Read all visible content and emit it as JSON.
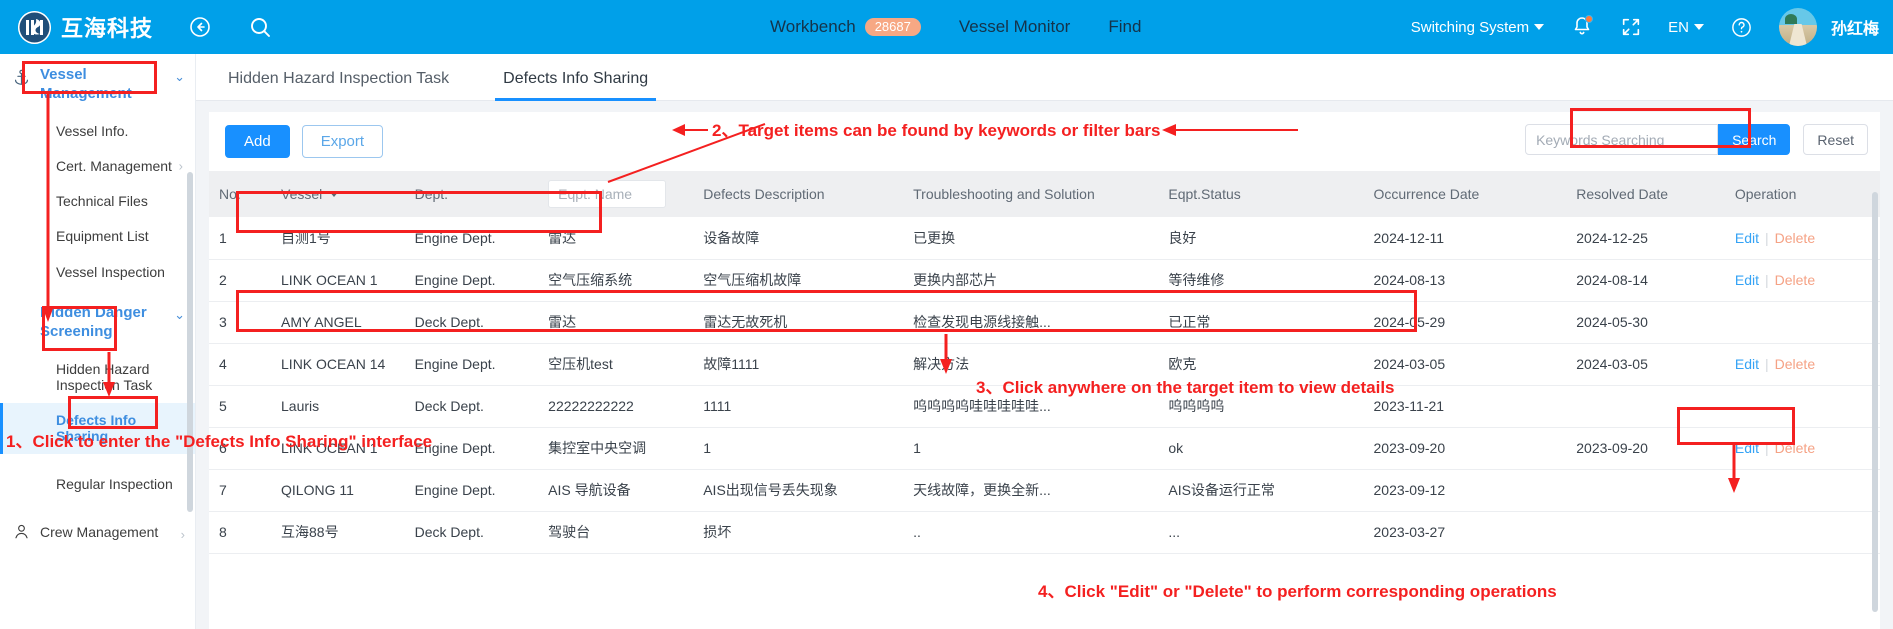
{
  "topbar": {
    "brand_name": "互海科技",
    "back_icon": "back-arrow-icon",
    "search_icon": "search-icon",
    "nav": [
      {
        "label": "Workbench",
        "badge": "28687"
      },
      {
        "label": "Vessel Monitor",
        "badge": ""
      },
      {
        "label": "Find",
        "badge": ""
      }
    ],
    "switching_system": "Switching System",
    "language": "EN",
    "user_name": "孙红梅"
  },
  "sidebar": {
    "groups": [
      {
        "label": "Vessel Management",
        "icon": "anchor-icon",
        "expanded": true,
        "items": [
          {
            "label": "Vessel Info.",
            "has_arrow": false
          },
          {
            "label": "Cert. Management",
            "has_arrow": true
          },
          {
            "label": "Technical Files",
            "has_arrow": false
          },
          {
            "label": "Equipment List",
            "has_arrow": false
          },
          {
            "label": "Vessel Inspection",
            "has_arrow": false
          }
        ]
      },
      {
        "label": "Hidden Danger Screening",
        "icon": "chevron-down-icon",
        "expanded": true,
        "items": [
          {
            "label": "Hidden Hazard Inspection Task",
            "has_arrow": false
          },
          {
            "label": "Defects Info Sharing",
            "has_arrow": false,
            "active": true
          },
          {
            "label": "Regular Inspection",
            "has_arrow": false
          }
        ]
      },
      {
        "label": "Crew Management",
        "icon": "user-icon",
        "expanded": false,
        "items": []
      }
    ]
  },
  "tabs": [
    {
      "label": "Hidden Hazard Inspection Task",
      "active": false
    },
    {
      "label": "Defects Info Sharing",
      "active": true
    }
  ],
  "toolbar": {
    "add_label": "Add",
    "export_label": "Export",
    "search_placeholder": "Keywords Searching",
    "search_value": "",
    "search_label": "Search",
    "reset_label": "Reset"
  },
  "table": {
    "columns": [
      "No.",
      "Vessel",
      "Dept.",
      "Eqpt. Name",
      "Defects Description",
      "Troubleshooting and Solution",
      "Eqpt.Status",
      "Occurrence Date",
      "Resolved Date",
      "Operation"
    ],
    "eqpt_filter_placeholder": "Eqpt. Name",
    "eqpt_filter_value": "",
    "op_edit": "Edit",
    "op_delete": "Delete",
    "rows": [
      {
        "no": "1",
        "vessel": "自测1号",
        "dept": "Engine Dept.",
        "eqpt": "雷达",
        "desc": "设备故障",
        "solution": "已更换",
        "status": "良好",
        "occurrence": "2024-12-11",
        "resolved": "2024-12-25",
        "has_ops": true
      },
      {
        "no": "2",
        "vessel": "LINK OCEAN 1",
        "dept": "Engine Dept.",
        "eqpt": "空气压缩系统",
        "desc": "空气压缩机故障",
        "solution": "更换内部芯片",
        "status": "等待维修",
        "occurrence": "2024-08-13",
        "resolved": "2024-08-14",
        "has_ops": true
      },
      {
        "no": "3",
        "vessel": "AMY ANGEL",
        "dept": "Deck Dept.",
        "eqpt": "雷达",
        "desc": "雷达无故死机",
        "solution": "检查发现电源线接触...",
        "status": "已正常",
        "occurrence": "2024-05-29",
        "resolved": "2024-05-30",
        "has_ops": false
      },
      {
        "no": "4",
        "vessel": "LINK OCEAN 14",
        "dept": "Engine Dept.",
        "eqpt": "空压机test",
        "desc": "故障1111",
        "solution": "解决方法",
        "status": "欧克",
        "occurrence": "2024-03-05",
        "resolved": "2024-03-05",
        "has_ops": true
      },
      {
        "no": "5",
        "vessel": "Lauris",
        "dept": "Deck Dept.",
        "eqpt": "22222222222",
        "desc": "1111",
        "solution": "呜呜呜呜哇哇哇哇哇...",
        "status": "呜呜呜呜",
        "occurrence": "2023-11-21",
        "resolved": "",
        "has_ops": false
      },
      {
        "no": "6",
        "vessel": "LINK OCEAN 1",
        "dept": "Engine Dept.",
        "eqpt": "集控室中央空调",
        "desc": "1",
        "solution": "1",
        "status": "ok",
        "occurrence": "2023-09-20",
        "resolved": "2023-09-20",
        "has_ops": true
      },
      {
        "no": "7",
        "vessel": "QILONG 11",
        "dept": "Engine Dept.",
        "eqpt": "AIS 导航设备",
        "desc": "AIS出现信号丢失现象",
        "solution": "天线故障，更换全新...",
        "status": "AIS设备运行正常",
        "occurrence": "2023-09-12",
        "resolved": "",
        "has_ops": false
      },
      {
        "no": "8",
        "vessel": "互海88号",
        "dept": "Deck Dept.",
        "eqpt": "驾驶台",
        "desc": "损坏",
        "solution": "..",
        "status": "...",
        "occurrence": "2023-03-27",
        "resolved": "",
        "has_ops": false
      }
    ]
  },
  "annotations": {
    "step1": "1、Click to enter the \"Defects Info Sharing\" interface",
    "step2": "2、Target items can be found by keywords or filter bars",
    "step3": "3、Click anywhere on the target item to view details",
    "step4": "4、Click \"Edit\" or \"Delete\" to perform corresponding operations",
    "color": "#f42020"
  }
}
